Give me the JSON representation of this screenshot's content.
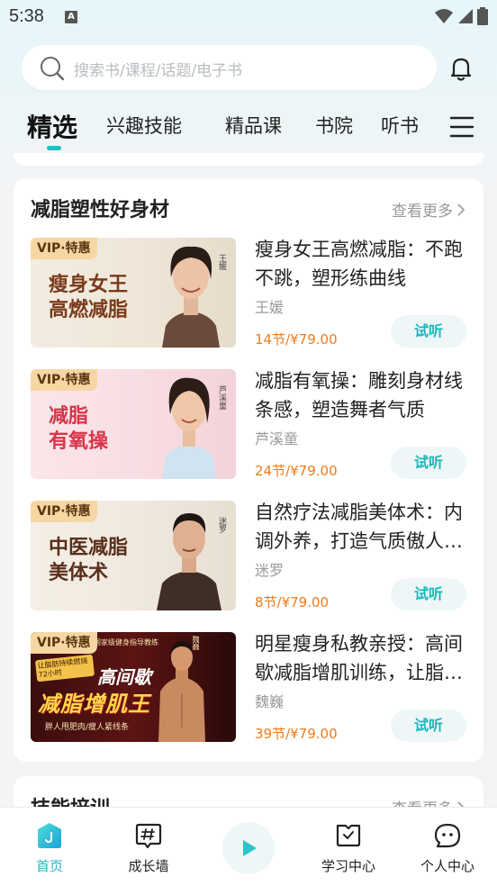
{
  "status_bar": {
    "time": "5:38",
    "a_icon": "A"
  },
  "search": {
    "placeholder": "搜索书/课程/话题/电子书"
  },
  "tabs": [
    {
      "label": "精选",
      "active": true
    },
    {
      "label": "兴趣技能",
      "active": false
    },
    {
      "label": "精品课",
      "active": false
    },
    {
      "label": "书院",
      "active": false
    },
    {
      "label": "听书",
      "active": false
    }
  ],
  "section1": {
    "title": "减脂塑性好身材",
    "more_label": "查看更多",
    "items": [
      {
        "badge": "VIP·特惠",
        "thumb_lines": [
          "瘦身女王",
          "高燃减脂"
        ],
        "thumb_name": "王媛",
        "title": "瘦身女王高燃减脂：不跑不跳，塑形练曲线",
        "author": "王媛",
        "price": "14节/¥79.00",
        "button": "试听"
      },
      {
        "badge": "VIP·特惠",
        "thumb_lines": [
          "减脂",
          "有氧操"
        ],
        "thumb_name": "芦溪童",
        "title": "减脂有氧操：雕刻身材线条感，塑造舞者气质",
        "author": "芦溪童",
        "price": "24节/¥79.00",
        "button": "试听"
      },
      {
        "badge": "VIP·特惠",
        "thumb_lines": [
          "中医减脂",
          "美体术"
        ],
        "thumb_name": "迷罗",
        "title": "自然疗法减脂美体术：内调外养，打造气质傲人身材",
        "author": "迷罗",
        "price": "8节/¥79.00",
        "button": "试听"
      },
      {
        "badge": "VIP·特惠",
        "thumb_lines": [
          "高间歇",
          "减脂增肌王"
        ],
        "thumb_top": "国家级健身指导教练",
        "thumb_badge": "让脂肪持续燃烧72小时",
        "thumb_sub": "胖人甩肥肉/瘦人紧线条",
        "thumb_name": "魏巍",
        "title": "明星瘦身私教亲授：高间歇减脂增肌训练，让脂肪持续燃烧",
        "author": "魏巍",
        "price": "39节/¥79.00",
        "button": "试听"
      }
    ]
  },
  "section2": {
    "title": "技能培训",
    "more_label": "查看更多"
  },
  "bottom_nav": [
    {
      "label": "首页",
      "icon": "home-icon",
      "active": true
    },
    {
      "label": "成长墙",
      "icon": "hashtag-icon",
      "active": false
    },
    {
      "label": "学习中心",
      "icon": "study-icon",
      "active": false
    },
    {
      "label": "个人中心",
      "icon": "profile-icon",
      "active": false
    }
  ],
  "colors": {
    "accent": "#19c3c1",
    "price": "#f07a1a",
    "vip_bg": "#f6d7a3",
    "bg": "#f3f4f6"
  }
}
